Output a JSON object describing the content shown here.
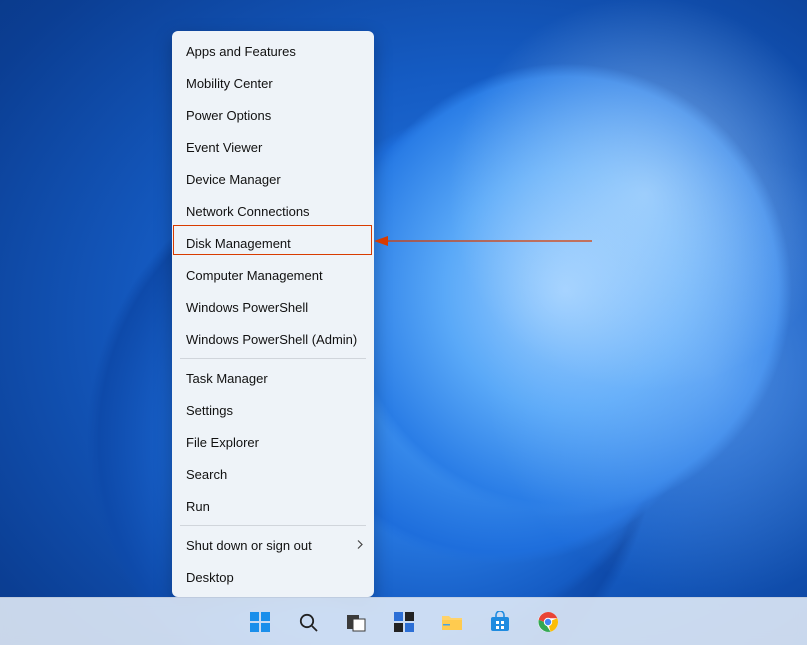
{
  "menu": {
    "group1": [
      "Apps and Features",
      "Mobility Center",
      "Power Options",
      "Event Viewer",
      "Device Manager",
      "Network Connections",
      "Disk Management",
      "Computer Management",
      "Windows PowerShell",
      "Windows PowerShell (Admin)"
    ],
    "group2": [
      "Task Manager",
      "Settings",
      "File Explorer",
      "Search",
      "Run"
    ],
    "group3": [
      {
        "label": "Shut down or sign out",
        "submenu": true
      },
      {
        "label": "Desktop",
        "submenu": false
      }
    ],
    "highlighted": "Disk Management"
  },
  "taskbar": {
    "items": [
      "start",
      "search",
      "task-view",
      "widgets",
      "file-explorer",
      "microsoft-store",
      "chrome"
    ]
  },
  "annotation": {
    "highlight_color": "#d83b00"
  }
}
